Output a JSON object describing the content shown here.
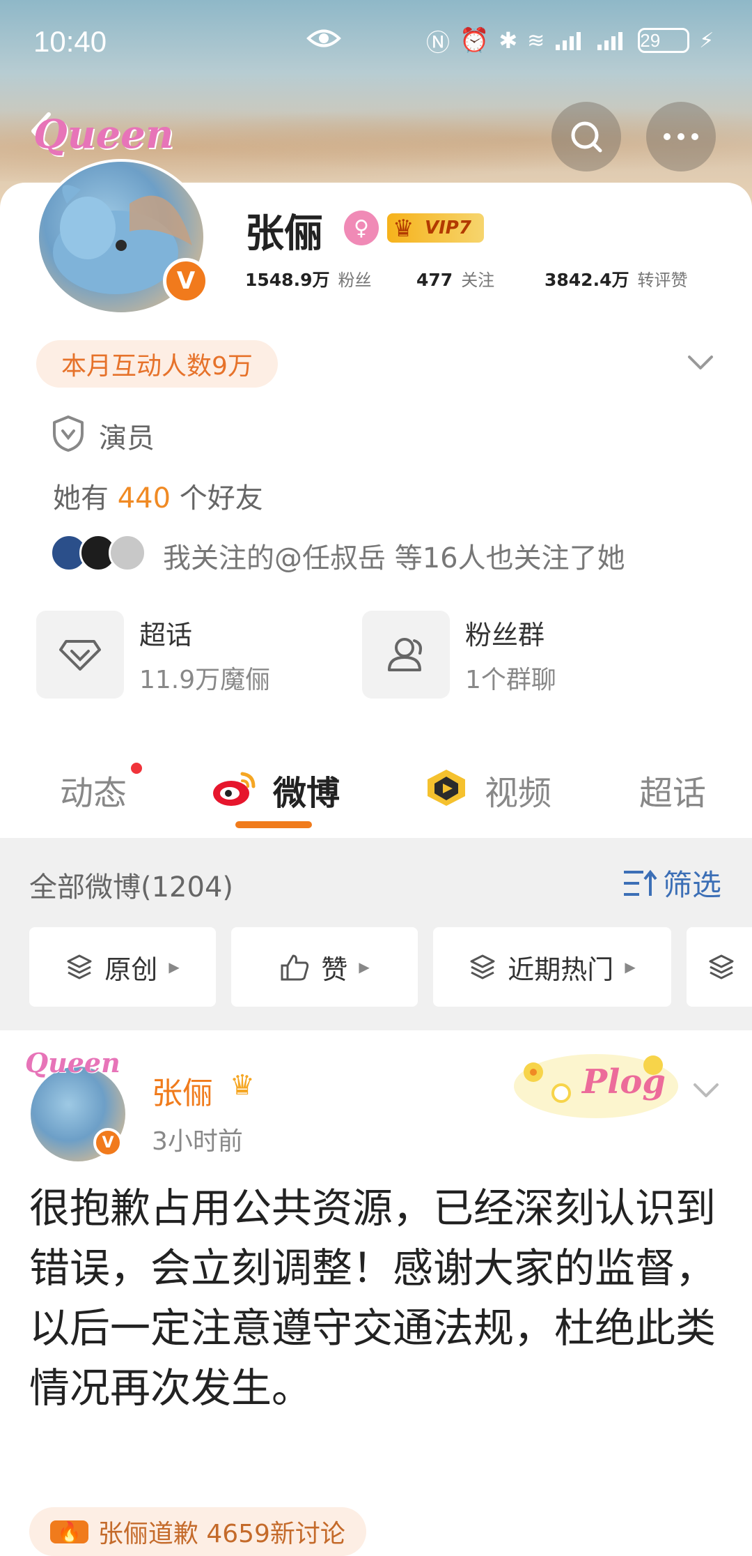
{
  "status_bar": {
    "time": "10:40",
    "battery": "29"
  },
  "header": {
    "brand_sticker": "Queen"
  },
  "profile": {
    "name": "张俪",
    "vip_label": "VIP7",
    "verified_mark": "V",
    "stats": [
      {
        "value": "1548.9万",
        "label": "粉丝"
      },
      {
        "value": "477",
        "label": "关注"
      },
      {
        "value": "3842.4万",
        "label": "转评赞"
      }
    ],
    "interaction_label": "本月互动人数9万",
    "occupation": "演员",
    "friends_prefix": "她有",
    "friends_count": "440",
    "friends_suffix": "个好友",
    "mutual_follow_text": "我关注的@任叔岳 等16人也关注了她",
    "features": [
      {
        "title": "超话",
        "subtitle": "11.9万魔俪"
      },
      {
        "title": "粉丝群",
        "subtitle": "1个群聊"
      }
    ]
  },
  "tabs": [
    {
      "label": "动态"
    },
    {
      "label": "微博"
    },
    {
      "label": "视频"
    },
    {
      "label": "超话"
    }
  ],
  "feed": {
    "all_label": "全部微博(1204)",
    "filter_label": "筛选",
    "chips": [
      {
        "label": "原创"
      },
      {
        "label": "赞"
      },
      {
        "label": "近期热门"
      }
    ]
  },
  "post": {
    "author": "张俪",
    "time": "3小时前",
    "sticker_text": "Plog",
    "content": "很抱歉占用公共资源，已经深刻认识到错误，会立刻调整！感谢大家的监督，以后一定注意遵守交通法规，杜绝此类情况再次发生。",
    "topic_text": "张俪道歉 4659新讨论"
  },
  "colors": {
    "accent": "#f07b1c",
    "link": "#3c6fb6",
    "highlight": "#f08a24"
  }
}
